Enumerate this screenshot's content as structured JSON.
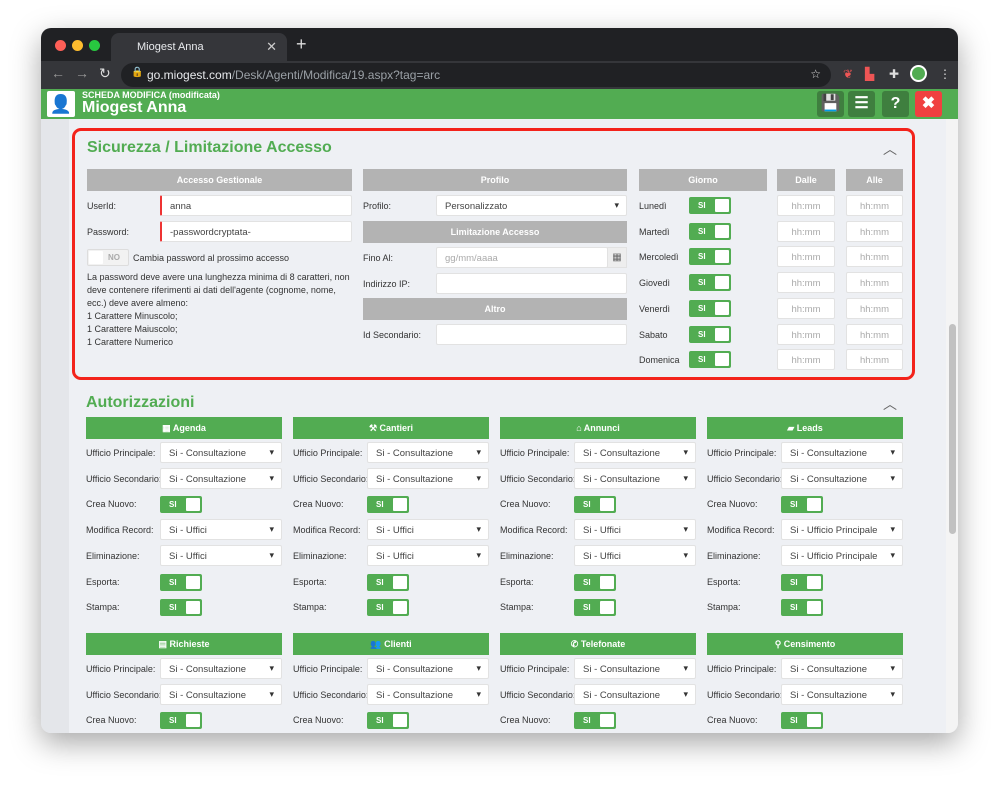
{
  "browser": {
    "tab_title": "Miogest Anna",
    "url_host": "go.miogest.com",
    "url_path": "/Desk/Agenti/Modifica/19.aspx?tag=arc"
  },
  "header": {
    "subtitle": "SCHEDA MODIFICA (modificata)",
    "title": "Miogest Anna"
  },
  "sicurezza": {
    "title": "Sicurezza / Limitazione Accesso",
    "accesso_header": "Accesso Gestionale",
    "userid_label": "UserId:",
    "userid_value": "anna",
    "password_label": "Password:",
    "password_value": "-passwordcryptata-",
    "change_pw_toggle": "NO",
    "change_pw_label": "Cambia password al prossimo accesso",
    "rules": [
      "La password deve avere una lunghezza minima di 8 caratteri, non deve contenere riferimenti ai dati dell'agente (cognome, nome, ecc.) deve avere almeno:",
      "1 Carattere Minuscolo;",
      "1 Carattere Maiuscolo;",
      "1 Carattere Numerico"
    ],
    "profilo_header": "Profilo",
    "profilo_label": "Profilo:",
    "profilo_value": "Personalizzato",
    "limitazione_header": "Limitazione Accesso",
    "fino_label": "Fino Al:",
    "fino_placeholder": "gg/mm/aaaa",
    "ip_label": "Indirizzo IP:",
    "altro_header": "Altro",
    "idsec_label": "Id Secondario:",
    "giorno_header": "Giorno",
    "dalle_header": "Dalle",
    "alle_header": "Alle",
    "time_placeholder": "hh:mm",
    "days": [
      {
        "name": "Lunedì",
        "on": "SI"
      },
      {
        "name": "Martedì",
        "on": "SI"
      },
      {
        "name": "Mercoledì",
        "on": "SI"
      },
      {
        "name": "Giovedì",
        "on": "SI"
      },
      {
        "name": "Venerdì",
        "on": "SI"
      },
      {
        "name": "Sabato",
        "on": "SI"
      },
      {
        "name": "Domenica",
        "on": "SI"
      }
    ]
  },
  "autorizzazioni": {
    "title": "Autorizzazioni",
    "modules": [
      {
        "title": "Agenda",
        "icon": "calendar-icon",
        "glyph": "▦",
        "rows": [
          [
            "Ufficio Principale:",
            "select",
            "Si - Consultazione"
          ],
          [
            "Ufficio Secondario:",
            "select",
            "Si - Consultazione"
          ],
          [
            "Crea Nuovo:",
            "toggle",
            "SI"
          ],
          [
            "Modifica Record:",
            "select",
            "Si - Uffici"
          ],
          [
            "Eliminazione:",
            "select",
            "Si - Uffici"
          ],
          [
            "Esporta:",
            "toggle",
            "SI"
          ],
          [
            "Stampa:",
            "toggle",
            "SI"
          ]
        ]
      },
      {
        "title": "Cantieri",
        "icon": "tools-icon",
        "glyph": "⚒",
        "rows": [
          [
            "Ufficio Principale:",
            "select",
            "Si - Consultazione"
          ],
          [
            "Ufficio Secondario:",
            "select",
            "Si - Consultazione"
          ],
          [
            "Crea Nuovo:",
            "toggle",
            "SI"
          ],
          [
            "Modifica Record:",
            "select",
            "Si - Uffici"
          ],
          [
            "Eliminazione:",
            "select",
            "Si - Uffici"
          ],
          [
            "Esporta:",
            "toggle",
            "SI"
          ],
          [
            "Stampa:",
            "toggle",
            "SI"
          ]
        ]
      },
      {
        "title": "Annunci",
        "icon": "home-icon",
        "glyph": "⌂",
        "rows": [
          [
            "Ufficio Principale:",
            "select",
            "Si - Consultazione"
          ],
          [
            "Ufficio Secondario:",
            "select",
            "Si - Consultazione"
          ],
          [
            "Crea Nuovo:",
            "toggle",
            "SI"
          ],
          [
            "Modifica Record:",
            "select",
            "Si - Uffici"
          ],
          [
            "Eliminazione:",
            "select",
            "Si - Uffici"
          ],
          [
            "Esporta:",
            "toggle",
            "SI"
          ],
          [
            "Stampa:",
            "toggle",
            "SI"
          ]
        ]
      },
      {
        "title": "Leads",
        "icon": "comment-icon",
        "glyph": "▰",
        "rows": [
          [
            "Ufficio Principale:",
            "select",
            "Si - Consultazione"
          ],
          [
            "Ufficio Secondario:",
            "select",
            "Si - Consultazione"
          ],
          [
            "Crea Nuovo:",
            "toggle",
            "SI"
          ],
          [
            "Modifica Record:",
            "select",
            "Si - Ufficio Principale"
          ],
          [
            "Eliminazione:",
            "select",
            "Si - Ufficio Principale"
          ],
          [
            "Esporta:",
            "toggle",
            "SI"
          ],
          [
            "Stampa:",
            "toggle",
            "SI"
          ]
        ]
      },
      {
        "title": "Richieste",
        "icon": "list-icon",
        "glyph": "▤",
        "rows": [
          [
            "Ufficio Principale:",
            "select",
            "Si - Consultazione"
          ],
          [
            "Ufficio Secondario:",
            "select",
            "Si - Consultazione"
          ],
          [
            "Crea Nuovo:",
            "toggle",
            "SI"
          ]
        ]
      },
      {
        "title": "Clienti",
        "icon": "users-icon",
        "glyph": "👥",
        "rows": [
          [
            "Ufficio Principale:",
            "select",
            "Si - Consultazione"
          ],
          [
            "Ufficio Secondario:",
            "select",
            "Si - Consultazione"
          ],
          [
            "Crea Nuovo:",
            "toggle",
            "SI"
          ]
        ]
      },
      {
        "title": "Telefonate",
        "icon": "phone-icon",
        "glyph": "✆",
        "rows": [
          [
            "Ufficio Principale:",
            "select",
            "Si - Consultazione"
          ],
          [
            "Ufficio Secondario:",
            "select",
            "Si - Consultazione"
          ],
          [
            "Crea Nuovo:",
            "toggle",
            "SI"
          ]
        ]
      },
      {
        "title": "Censimento",
        "icon": "map-marker-icon",
        "glyph": "⚲",
        "rows": [
          [
            "Ufficio Principale:",
            "select",
            "Si - Consultazione"
          ],
          [
            "Ufficio Secondario:",
            "select",
            "Si - Consultazione"
          ],
          [
            "Crea Nuovo:",
            "toggle",
            "SI"
          ]
        ]
      }
    ]
  }
}
